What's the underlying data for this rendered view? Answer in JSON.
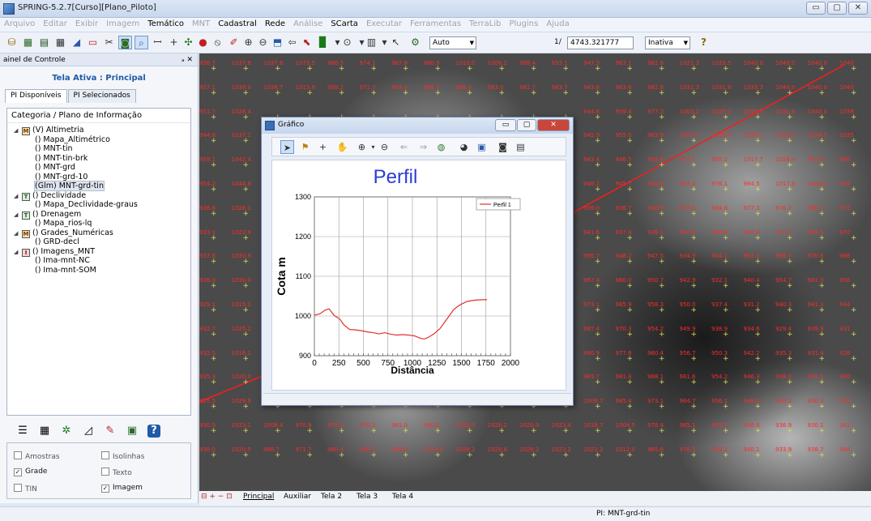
{
  "window": {
    "title": "SPRING-5.2.7[Curso][Plano_Piloto]"
  },
  "menu": [
    {
      "label": "Arquivo",
      "enabled": false
    },
    {
      "label": "Editar",
      "enabled": false
    },
    {
      "label": "Exibir",
      "enabled": false
    },
    {
      "label": "Imagem",
      "enabled": false
    },
    {
      "label": "Temático",
      "enabled": true
    },
    {
      "label": "MNT",
      "enabled": false
    },
    {
      "label": "Cadastral",
      "enabled": true
    },
    {
      "label": "Rede",
      "enabled": true
    },
    {
      "label": "Análise",
      "enabled": false
    },
    {
      "label": "SCarta",
      "enabled": true
    },
    {
      "label": "Executar",
      "enabled": false
    },
    {
      "label": "Ferramentas",
      "enabled": false
    },
    {
      "label": "TerraLib",
      "enabled": false
    },
    {
      "label": "Plugins",
      "enabled": false
    },
    {
      "label": "Ajuda",
      "enabled": false
    }
  ],
  "toolbar": {
    "mode": "Auto",
    "scale_prefix": "1/",
    "scale_value": "4743.321777",
    "state": "Inativa"
  },
  "panel": {
    "title": "ainel de Controle",
    "pin": "ₐ ✕",
    "active_screen": "Tela Ativa : Principal",
    "tabs": [
      "PI Disponíveis",
      "PI Selecionados"
    ],
    "tree_header": "Categoria / Plano de Informação",
    "tree": [
      {
        "label": "(V) Altimetria",
        "badge": "M",
        "level": 0,
        "exp": "◢"
      },
      {
        "label": "() Mapa_Altimétrico",
        "level": 1
      },
      {
        "label": "() MNT-tin",
        "level": 1
      },
      {
        "label": "() MNT-tin-brk",
        "level": 1
      },
      {
        "label": "() MNT-grd",
        "level": 1
      },
      {
        "label": "() MNT-grd-10",
        "level": 1
      },
      {
        "label": "(Glm) MNT-grd-tin",
        "level": 1,
        "selected": true
      },
      {
        "label": "() Declividade",
        "badge": "T",
        "level": 0,
        "exp": "◢"
      },
      {
        "label": "() Mapa_Declividade-graus",
        "level": 1
      },
      {
        "label": "() Drenagem",
        "badge": "T",
        "level": 0,
        "exp": "◢"
      },
      {
        "label": "() Mapa_rios-lq",
        "level": 1
      },
      {
        "label": "() Grades_Numéricas",
        "badge": "M",
        "level": 0,
        "exp": "◢"
      },
      {
        "label": "() GRD-decl",
        "level": 1
      },
      {
        "label": "() Imagens_MNT",
        "badge": "I",
        "level": 0,
        "exp": "◢"
      },
      {
        "label": "() Ima-mnt-NC",
        "level": 1
      },
      {
        "label": "() Ima-mnt-SOM",
        "level": 1
      }
    ],
    "checks": [
      {
        "label": "Amostras",
        "checked": false
      },
      {
        "label": "Isolinhas",
        "checked": false
      },
      {
        "label": "Grade",
        "checked": true
      },
      {
        "label": "Texto",
        "checked": false
      },
      {
        "label": "TIN",
        "checked": false
      },
      {
        "label": "Imagem",
        "checked": true
      }
    ]
  },
  "map": {
    "grid": [
      [
        "956.7",
        "1037.6",
        "1037.6",
        "1073.5",
        "960.5",
        "974.1",
        "967.8",
        "960.9",
        "1010.0",
        "1006.2",
        "998.4",
        "953.1",
        "947.3",
        "967.1",
        "982.6",
        "1021.3",
        "1035.5",
        "1040.0",
        "1040.0",
        "1040.0",
        "1040"
      ],
      [
        "957.1",
        "1039.0",
        "1038.7",
        "1015.9",
        "989.2",
        "971.7",
        "964.0",
        "969.7",
        "986.4",
        "983.0",
        "981.7",
        "983.7",
        "943.8",
        "963.6",
        "982.6",
        "1031.3",
        "1031.8",
        "1033.3",
        "1040.0",
        "1040.0",
        "1040"
      ],
      [
        "951.7",
        "1028.4",
        "",
        "",
        "",
        "",
        "",
        "",
        "",
        "",
        "",
        "",
        "944.8",
        "959.4",
        "977.3",
        "1003.2",
        "1025.5",
        "1025.5",
        "1031.4",
        "1040.0",
        "1038"
      ],
      [
        "944.8",
        "1037.1",
        "",
        "",
        "",
        "",
        "",
        "",
        "",
        "",
        "",
        "",
        "945.9",
        "955.0",
        "963.9",
        "1007.3",
        "1016.4",
        "1026.1",
        "1022.5",
        "1034.5",
        "1035"
      ],
      [
        "959.1",
        "1042.4",
        "",
        "",
        "",
        "",
        "",
        "",
        "",
        "",
        "",
        "",
        "943.4",
        "946.5",
        "958.8",
        "977.7",
        "985.2",
        "1017.7",
        "1028.4",
        "991.8",
        "986"
      ],
      [
        "954.2",
        "1044.8",
        "",
        "",
        "",
        "",
        "",
        "",
        "",
        "",
        "",
        "",
        "949.2",
        "945.7",
        "958.9",
        "967.0",
        "976.1",
        "984.5",
        "1017.8",
        "1006.2",
        "978"
      ],
      [
        "936.8",
        "1028.1",
        "",
        "",
        "",
        "",
        "",
        "",
        "",
        "",
        "",
        "",
        "939.0",
        "938.7",
        "949.9",
        "957.8",
        "984.6",
        "977.3",
        "976.7",
        "966.7",
        "972"
      ],
      [
        "933.1",
        "1022.9",
        "",
        "",
        "",
        "",
        "",
        "",
        "",
        "",
        "",
        "",
        "941.6",
        "937.4",
        "939.1",
        "947.6",
        "958.8",
        "967.8",
        "977.2",
        "983.5",
        "972"
      ],
      [
        "937.6",
        "1030.9",
        "",
        "",
        "",
        "",
        "",
        "",
        "",
        "",
        "",
        "",
        "956.7",
        "948.2",
        "947.5",
        "934.9",
        "944.1",
        "963.1",
        "969.7",
        "970.6",
        "966"
      ],
      [
        "936.0",
        "1030.0",
        "",
        "",
        "",
        "",
        "",
        "",
        "",
        "",
        "",
        "",
        "967.4",
        "960.0",
        "950.7",
        "942.9",
        "932.1",
        "940.4",
        "954.7",
        "961.3",
        "956"
      ],
      [
        "929.1",
        "1015.1",
        "",
        "",
        "",
        "",
        "",
        "",
        "",
        "",
        "",
        "",
        "973.1",
        "965.9",
        "958.3",
        "950.0",
        "937.4",
        "931.2",
        "940.3",
        "941.3",
        "944"
      ],
      [
        "932.7",
        "1025.2",
        "",
        "",
        "",
        "",
        "",
        "",
        "",
        "",
        "",
        "",
        "987.4",
        "970.3",
        "954.2",
        "949.9",
        "938.9",
        "934.6",
        "929.4",
        "939.9",
        "931"
      ],
      [
        "932.5",
        "1016.1",
        "",
        "",
        "",
        "",
        "",
        "",
        "",
        "",
        "",
        "",
        "990.9",
        "977.6",
        "960.4",
        "956.7",
        "950.3",
        "942.2",
        "935.3",
        "931.4",
        "928"
      ],
      [
        "935.3",
        "1020.0",
        "",
        "",
        "",
        "",
        "",
        "",
        "",
        "",
        "",
        "",
        "983.7",
        "981.4",
        "968.1",
        "961.6",
        "954.2",
        "946.3",
        "938.0",
        "931.1",
        "930"
      ],
      [
        "925.5",
        "1029.9",
        "1008.4",
        "973.1",
        "968.0",
        "974.4",
        "969.1",
        "981.5",
        "1010.0",
        "1026.7",
        "1031.1",
        "1021.0",
        "1009.7",
        "985.4",
        "973.1",
        "964.7",
        "956.1",
        "948.8",
        "936.2",
        "930.3",
        "935"
      ],
      [
        "930.0",
        "1023.1",
        "1008.4",
        "970.8",
        "974.1",
        "970.2",
        "981.0",
        "990.6",
        "1030.0",
        "1028.2",
        "1020.0",
        "1023.4",
        "1018.7",
        "1004.5",
        "978.4",
        "965.1",
        "955.7",
        "946.8",
        "936.9",
        "930.1",
        "941"
      ],
      [
        "930.0",
        "1020.5",
        "986.7",
        "971.7",
        "960.4",
        "988.1",
        "989.0",
        "1014.6",
        "1028.2",
        "1028.6",
        "1026.2",
        "1023.2",
        "1023.2",
        "1012.0",
        "985.6",
        "976.5",
        "959.2",
        "940.1",
        "933.9",
        "938.7",
        "946"
      ]
    ]
  },
  "graph": {
    "window_title": "Gráfico",
    "window_controls": [
      "▭",
      "▢",
      "✕"
    ]
  },
  "chart_data": {
    "type": "line",
    "title": "Perfil",
    "xlabel": "Distância",
    "ylabel": "Cota  m",
    "xlim": [
      0,
      2000
    ],
    "ylim": [
      900,
      1300
    ],
    "xticks": [
      0,
      250,
      500,
      750,
      1000,
      1250,
      1500,
      1750,
      2000
    ],
    "yticks": [
      900,
      1000,
      1100,
      1200,
      1300
    ],
    "grid": true,
    "legend": "top-right",
    "series": [
      {
        "name": "Perfil 1",
        "color": "#e03030",
        "x": [
          0,
          60,
          110,
          150,
          200,
          260,
          300,
          360,
          420,
          480,
          540,
          600,
          660,
          720,
          780,
          840,
          900,
          960,
          1020,
          1080,
          1120,
          1160,
          1220,
          1280,
          1330,
          1380,
          1420,
          1460,
          1500,
          1560,
          1640,
          1720,
          1760
        ],
        "values": [
          1002,
          1006,
          1015,
          1018,
          1002,
          992,
          978,
          966,
          965,
          963,
          960,
          958,
          955,
          958,
          954,
          952,
          953,
          952,
          950,
          944,
          942,
          946,
          955,
          968,
          985,
          1002,
          1016,
          1024,
          1030,
          1037,
          1040,
          1041,
          1041
        ]
      }
    ]
  },
  "bottom": {
    "nav": "⊟ + − ⊡",
    "tabs": [
      "Principal",
      "Auxiliar",
      "Tela 2",
      "Tela 3",
      "Tela 4"
    ]
  },
  "status": {
    "pi": "PI: MNT-grd-tin"
  }
}
